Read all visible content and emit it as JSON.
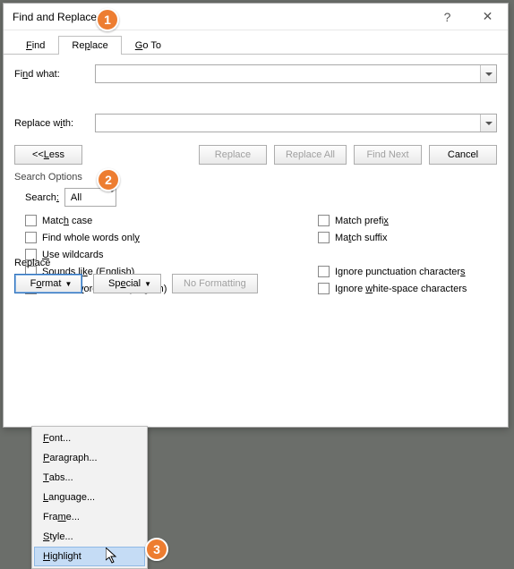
{
  "dialog": {
    "title": "Find and Replace",
    "help_tooltip": "?",
    "close_tooltip": "✕"
  },
  "tabs": {
    "find": "Find",
    "replace": "Replace",
    "goto": "Go To"
  },
  "fields": {
    "find_label_pre": "Fi",
    "find_label_u": "n",
    "find_label_post": "d what:",
    "find_value": "",
    "replace_label_pre": "Replace w",
    "replace_label_u": "i",
    "replace_label_post": "th:",
    "replace_value": ""
  },
  "buttons": {
    "less": "<< Less",
    "replace": "Replace",
    "replace_all": "Replace All",
    "find_next": "Find Next",
    "cancel": "Cancel"
  },
  "search_options": {
    "title": "Search Options",
    "search_label": "Search:",
    "search_value": "All",
    "match_case": "Match case",
    "whole_words": "Find whole words only",
    "use_wildcards": "Use wildcards",
    "sounds_like": "Sounds like (English)",
    "word_forms": "Find all word forms (English)",
    "match_prefix": "Match prefix",
    "match_suffix": "Match suffix",
    "ignore_punct": "Ignore punctuation characters",
    "ignore_ws": "Ignore white-space characters"
  },
  "footer": {
    "replace_title": "Replace",
    "format": "Format",
    "special": "Special",
    "no_formatting": "No Formatting"
  },
  "menu": {
    "font": "Font...",
    "paragraph": "Paragraph...",
    "tabs": "Tabs...",
    "language": "Language...",
    "frame": "Frame...",
    "style": "Style...",
    "highlight": "Highlight"
  },
  "callouts": {
    "one": "1",
    "two": "2",
    "three": "3"
  }
}
